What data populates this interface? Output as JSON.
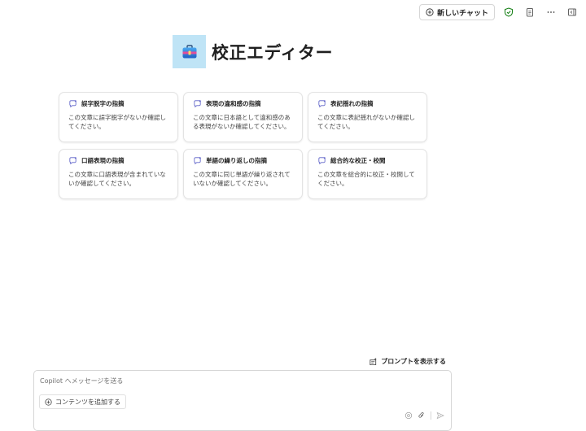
{
  "topbar": {
    "new_chat_label": "新しいチャット",
    "icons": [
      "plus-circle-icon",
      "shield-check-icon",
      "clipboard-icon",
      "more-icon",
      "sidebar-collapse-icon"
    ]
  },
  "header": {
    "title": "校正エディター",
    "logo_icon": "briefcase-icon"
  },
  "cards": [
    {
      "title": "誤字脱字の指摘",
      "desc": "この文章に誤字脱字がないか確認してください。"
    },
    {
      "title": "表現の違和感の指摘",
      "desc": "この文章に日本語として違和感のある表現がないか確認してください。"
    },
    {
      "title": "表記揺れの指摘",
      "desc": "この文章に表記揺れがないか確認してください。"
    },
    {
      "title": "口語表現の指摘",
      "desc": "この文章に口語表現が含まれていないか確認してください。"
    },
    {
      "title": "単語の繰り返しの指摘",
      "desc": "この文章に同じ単語が繰り返されていないか確認してください。"
    },
    {
      "title": "総合的な校正・校閲",
      "desc": "この文章を総合的に校正・校閲してください。"
    }
  ],
  "show_prompts_label": "プロンプトを表示する",
  "composer": {
    "placeholder": "Copilot へメッセージを送る",
    "add_content_label": "コンテンツを追加する"
  },
  "colors": {
    "accent": "#5b5fc7",
    "shield_green": "#107c10",
    "logo_bg": "#bfe4f6"
  }
}
